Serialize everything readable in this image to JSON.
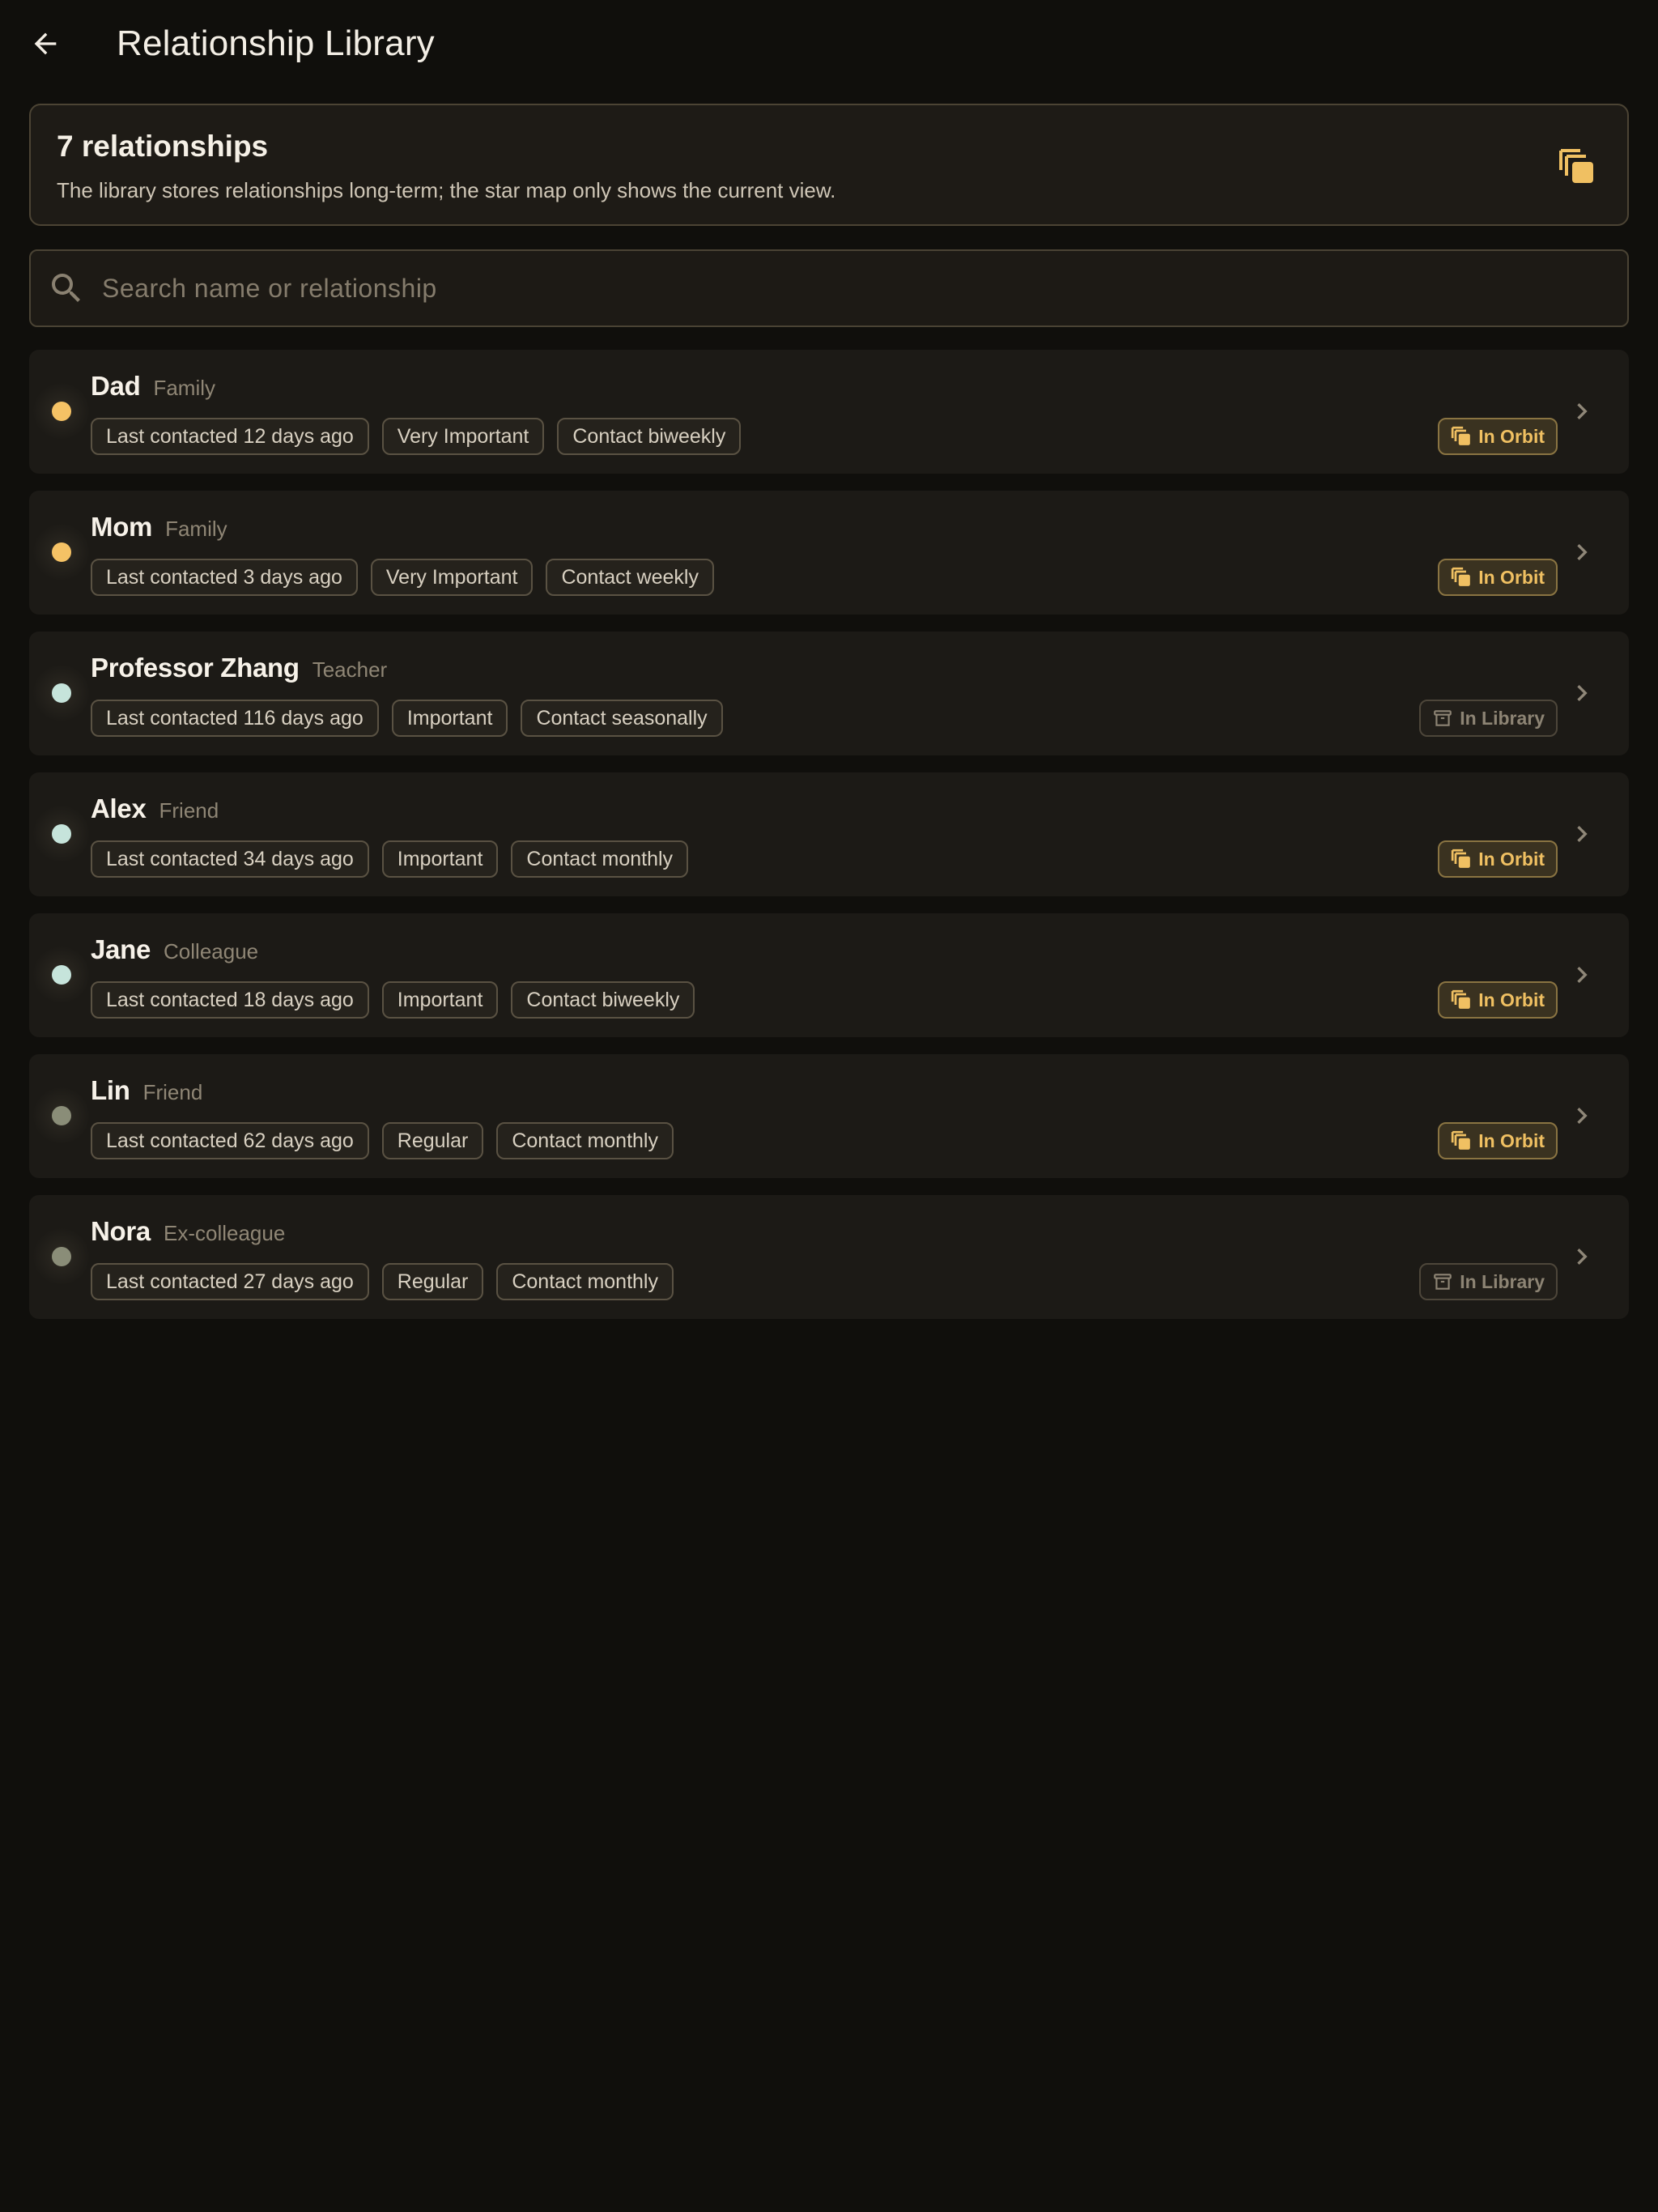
{
  "app_bar": {
    "title": "Relationship Library",
    "back_icon": "arrow-left-icon"
  },
  "summary": {
    "count_label": "7 relationships",
    "description": "The library stores relationships long-term; the star map only shows the current view.",
    "icon": "library-stack-icon"
  },
  "search": {
    "placeholder": "Search name or relationship",
    "value": "",
    "icon": "search-icon"
  },
  "colors": {
    "background": "#100f0c",
    "card": "#1c1a16",
    "accent_gold": "#f0c062",
    "dot_gold": "#f5c265",
    "dot_mint": "#c6e4db",
    "dot_olive": "#8a8d78"
  },
  "relationships": [
    {
      "name": "Dad",
      "relation": "Family",
      "dot_color": "#f5c265",
      "last_contacted": "Last contacted 12 days ago",
      "importance": "Very Important",
      "frequency": "Contact biweekly",
      "status": "In Orbit",
      "status_type": "orbit"
    },
    {
      "name": "Mom",
      "relation": "Family",
      "dot_color": "#f5c265",
      "last_contacted": "Last contacted 3 days ago",
      "importance": "Very Important",
      "frequency": "Contact weekly",
      "status": "In Orbit",
      "status_type": "orbit"
    },
    {
      "name": "Professor Zhang",
      "relation": "Teacher",
      "dot_color": "#c6e4db",
      "last_contacted": "Last contacted 116 days ago",
      "importance": "Important",
      "frequency": "Contact seasonally",
      "status": "In Library",
      "status_type": "library"
    },
    {
      "name": "Alex",
      "relation": "Friend",
      "dot_color": "#c6e4db",
      "last_contacted": "Last contacted 34 days ago",
      "importance": "Important",
      "frequency": "Contact monthly",
      "status": "In Orbit",
      "status_type": "orbit"
    },
    {
      "name": "Jane",
      "relation": "Colleague",
      "dot_color": "#c6e4db",
      "last_contacted": "Last contacted 18 days ago",
      "importance": "Important",
      "frequency": "Contact biweekly",
      "status": "In Orbit",
      "status_type": "orbit"
    },
    {
      "name": "Lin",
      "relation": "Friend",
      "dot_color": "#8a8d78",
      "last_contacted": "Last contacted 62 days ago",
      "importance": "Regular",
      "frequency": "Contact monthly",
      "status": "In Orbit",
      "status_type": "orbit"
    },
    {
      "name": "Nora",
      "relation": "Ex-colleague",
      "dot_color": "#8a8d78",
      "last_contacted": "Last contacted 27 days ago",
      "importance": "Regular",
      "frequency": "Contact monthly",
      "status": "In Library",
      "status_type": "library"
    }
  ]
}
